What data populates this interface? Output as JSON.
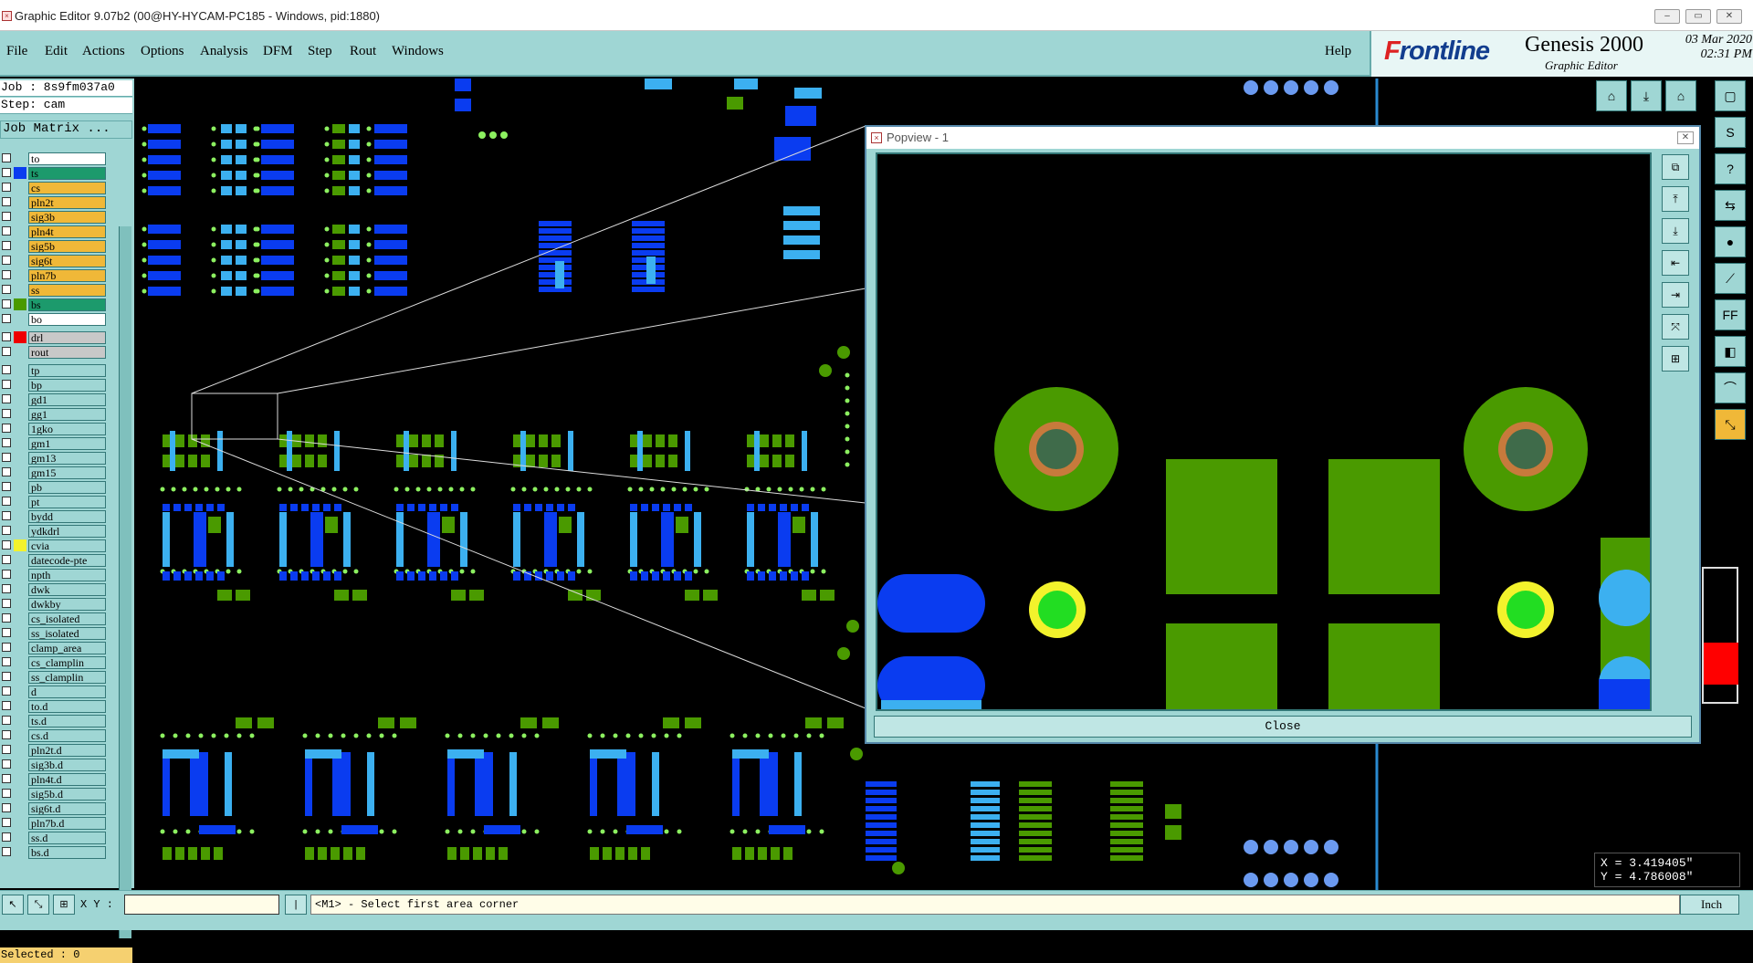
{
  "window": {
    "title": "Graphic Editor 9.07b2 (00@HY-HYCAM-PC185 - Windows, pid:1880)"
  },
  "menu": [
    "File",
    "Edit",
    "Actions",
    "Options",
    "Analysis",
    "DFM",
    "Step",
    "Rout",
    "Windows"
  ],
  "help_label": "Help",
  "brand": {
    "logo_prefix": "F",
    "logo_rest": "rontline",
    "product": "Genesis 2000",
    "subtitle": "Graphic Editor",
    "date": "03 Mar 2020",
    "time": "02:31 PM"
  },
  "job": {
    "job_line": "Job : 8s9fm037a0",
    "step_line": "Step: cam",
    "matrix_button": "Job Matrix ..."
  },
  "layers": [
    {
      "name": "to",
      "color": "#ffffff",
      "active": false
    },
    {
      "name": "ts",
      "color": "#1c9a6c",
      "active": true
    },
    {
      "name": "cs",
      "color": "#f0b838",
      "active": true
    },
    {
      "name": "pln2t",
      "color": "#f0b838",
      "active": true
    },
    {
      "name": "sig3b",
      "color": "#f0b838",
      "active": true
    },
    {
      "name": "pln4t",
      "color": "#f0b838",
      "active": true
    },
    {
      "name": "sig5b",
      "color": "#f0b838",
      "active": true
    },
    {
      "name": "sig6t",
      "color": "#f0b838",
      "active": true
    },
    {
      "name": "pln7b",
      "color": "#f0b838",
      "active": true
    },
    {
      "name": "ss",
      "color": "#f0b838",
      "active": true
    },
    {
      "name": "bs",
      "color": "#1c9a6c",
      "active": true
    },
    {
      "name": "bo",
      "color": "#ffffff",
      "active": false
    },
    {
      "name": "drl",
      "color": "#c8c8c8",
      "active": false
    },
    {
      "name": "rout",
      "color": "#c8c8c8",
      "active": false
    },
    {
      "name": "tp",
      "color": "#9fd6d4",
      "active": false
    },
    {
      "name": "bp",
      "color": "#9fd6d4",
      "active": false
    },
    {
      "name": "gd1",
      "color": "#9fd6d4",
      "active": false
    },
    {
      "name": "gg1",
      "color": "#9fd6d4",
      "active": false
    },
    {
      "name": "1gko",
      "color": "#9fd6d4",
      "active": false
    },
    {
      "name": "gm1",
      "color": "#9fd6d4",
      "active": false
    },
    {
      "name": "gm13",
      "color": "#9fd6d4",
      "active": false
    },
    {
      "name": "gm15",
      "color": "#9fd6d4",
      "active": false
    },
    {
      "name": "pb",
      "color": "#9fd6d4",
      "active": false
    },
    {
      "name": "pt",
      "color": "#9fd6d4",
      "active": false
    },
    {
      "name": "bydd",
      "color": "#9fd6d4",
      "active": false
    },
    {
      "name": "ydkdrl",
      "color": "#9fd6d4",
      "active": false
    },
    {
      "name": "cvia",
      "color": "#9fd6d4",
      "active": false
    },
    {
      "name": "datecode-pte",
      "color": "#9fd6d4",
      "active": false
    },
    {
      "name": "npth",
      "color": "#9fd6d4",
      "active": false
    },
    {
      "name": "dwk",
      "color": "#9fd6d4",
      "active": false
    },
    {
      "name": "dwkby",
      "color": "#9fd6d4",
      "active": false
    },
    {
      "name": "cs_isolated",
      "color": "#9fd6d4",
      "active": false
    },
    {
      "name": "ss_isolated",
      "color": "#9fd6d4",
      "active": false
    },
    {
      "name": "clamp_area",
      "color": "#9fd6d4",
      "active": false
    },
    {
      "name": "cs_clamplin",
      "color": "#9fd6d4",
      "active": false
    },
    {
      "name": "ss_clamplin",
      "color": "#9fd6d4",
      "active": false
    },
    {
      "name": "d",
      "color": "#9fd6d4",
      "active": false
    },
    {
      "name": "to.d",
      "color": "#9fd6d4",
      "active": false
    },
    {
      "name": "ts.d",
      "color": "#9fd6d4",
      "active": false
    },
    {
      "name": "cs.d",
      "color": "#9fd6d4",
      "active": false
    },
    {
      "name": "pln2t.d",
      "color": "#9fd6d4",
      "active": false
    },
    {
      "name": "sig3b.d",
      "color": "#9fd6d4",
      "active": false
    },
    {
      "name": "pln4t.d",
      "color": "#9fd6d4",
      "active": false
    },
    {
      "name": "sig5b.d",
      "color": "#9fd6d4",
      "active": false
    },
    {
      "name": "sig6t.d",
      "color": "#9fd6d4",
      "active": false
    },
    {
      "name": "pln7b.d",
      "color": "#9fd6d4",
      "active": false
    },
    {
      "name": "ss.d",
      "color": "#9fd6d4",
      "active": false
    },
    {
      "name": "bs.d",
      "color": "#9fd6d4",
      "active": false
    }
  ],
  "selected": "Selected : 0",
  "xy_label": "X Y :",
  "prompt": "<M1> - Select first area corner",
  "units": "Inch",
  "coords": {
    "x": "X = 3.419405\"",
    "y": "Y = 4.786008\""
  },
  "popup": {
    "title": "Popview - 1",
    "close_label": "Close"
  },
  "colors": {
    "panel": "#9fd6d4",
    "pad_green": "#4a9a00",
    "trace_blue": "#0a3cf0",
    "pad_cyan": "#3cb0f0",
    "via_yellow": "#f2f22c",
    "via_green": "#22dd22"
  }
}
